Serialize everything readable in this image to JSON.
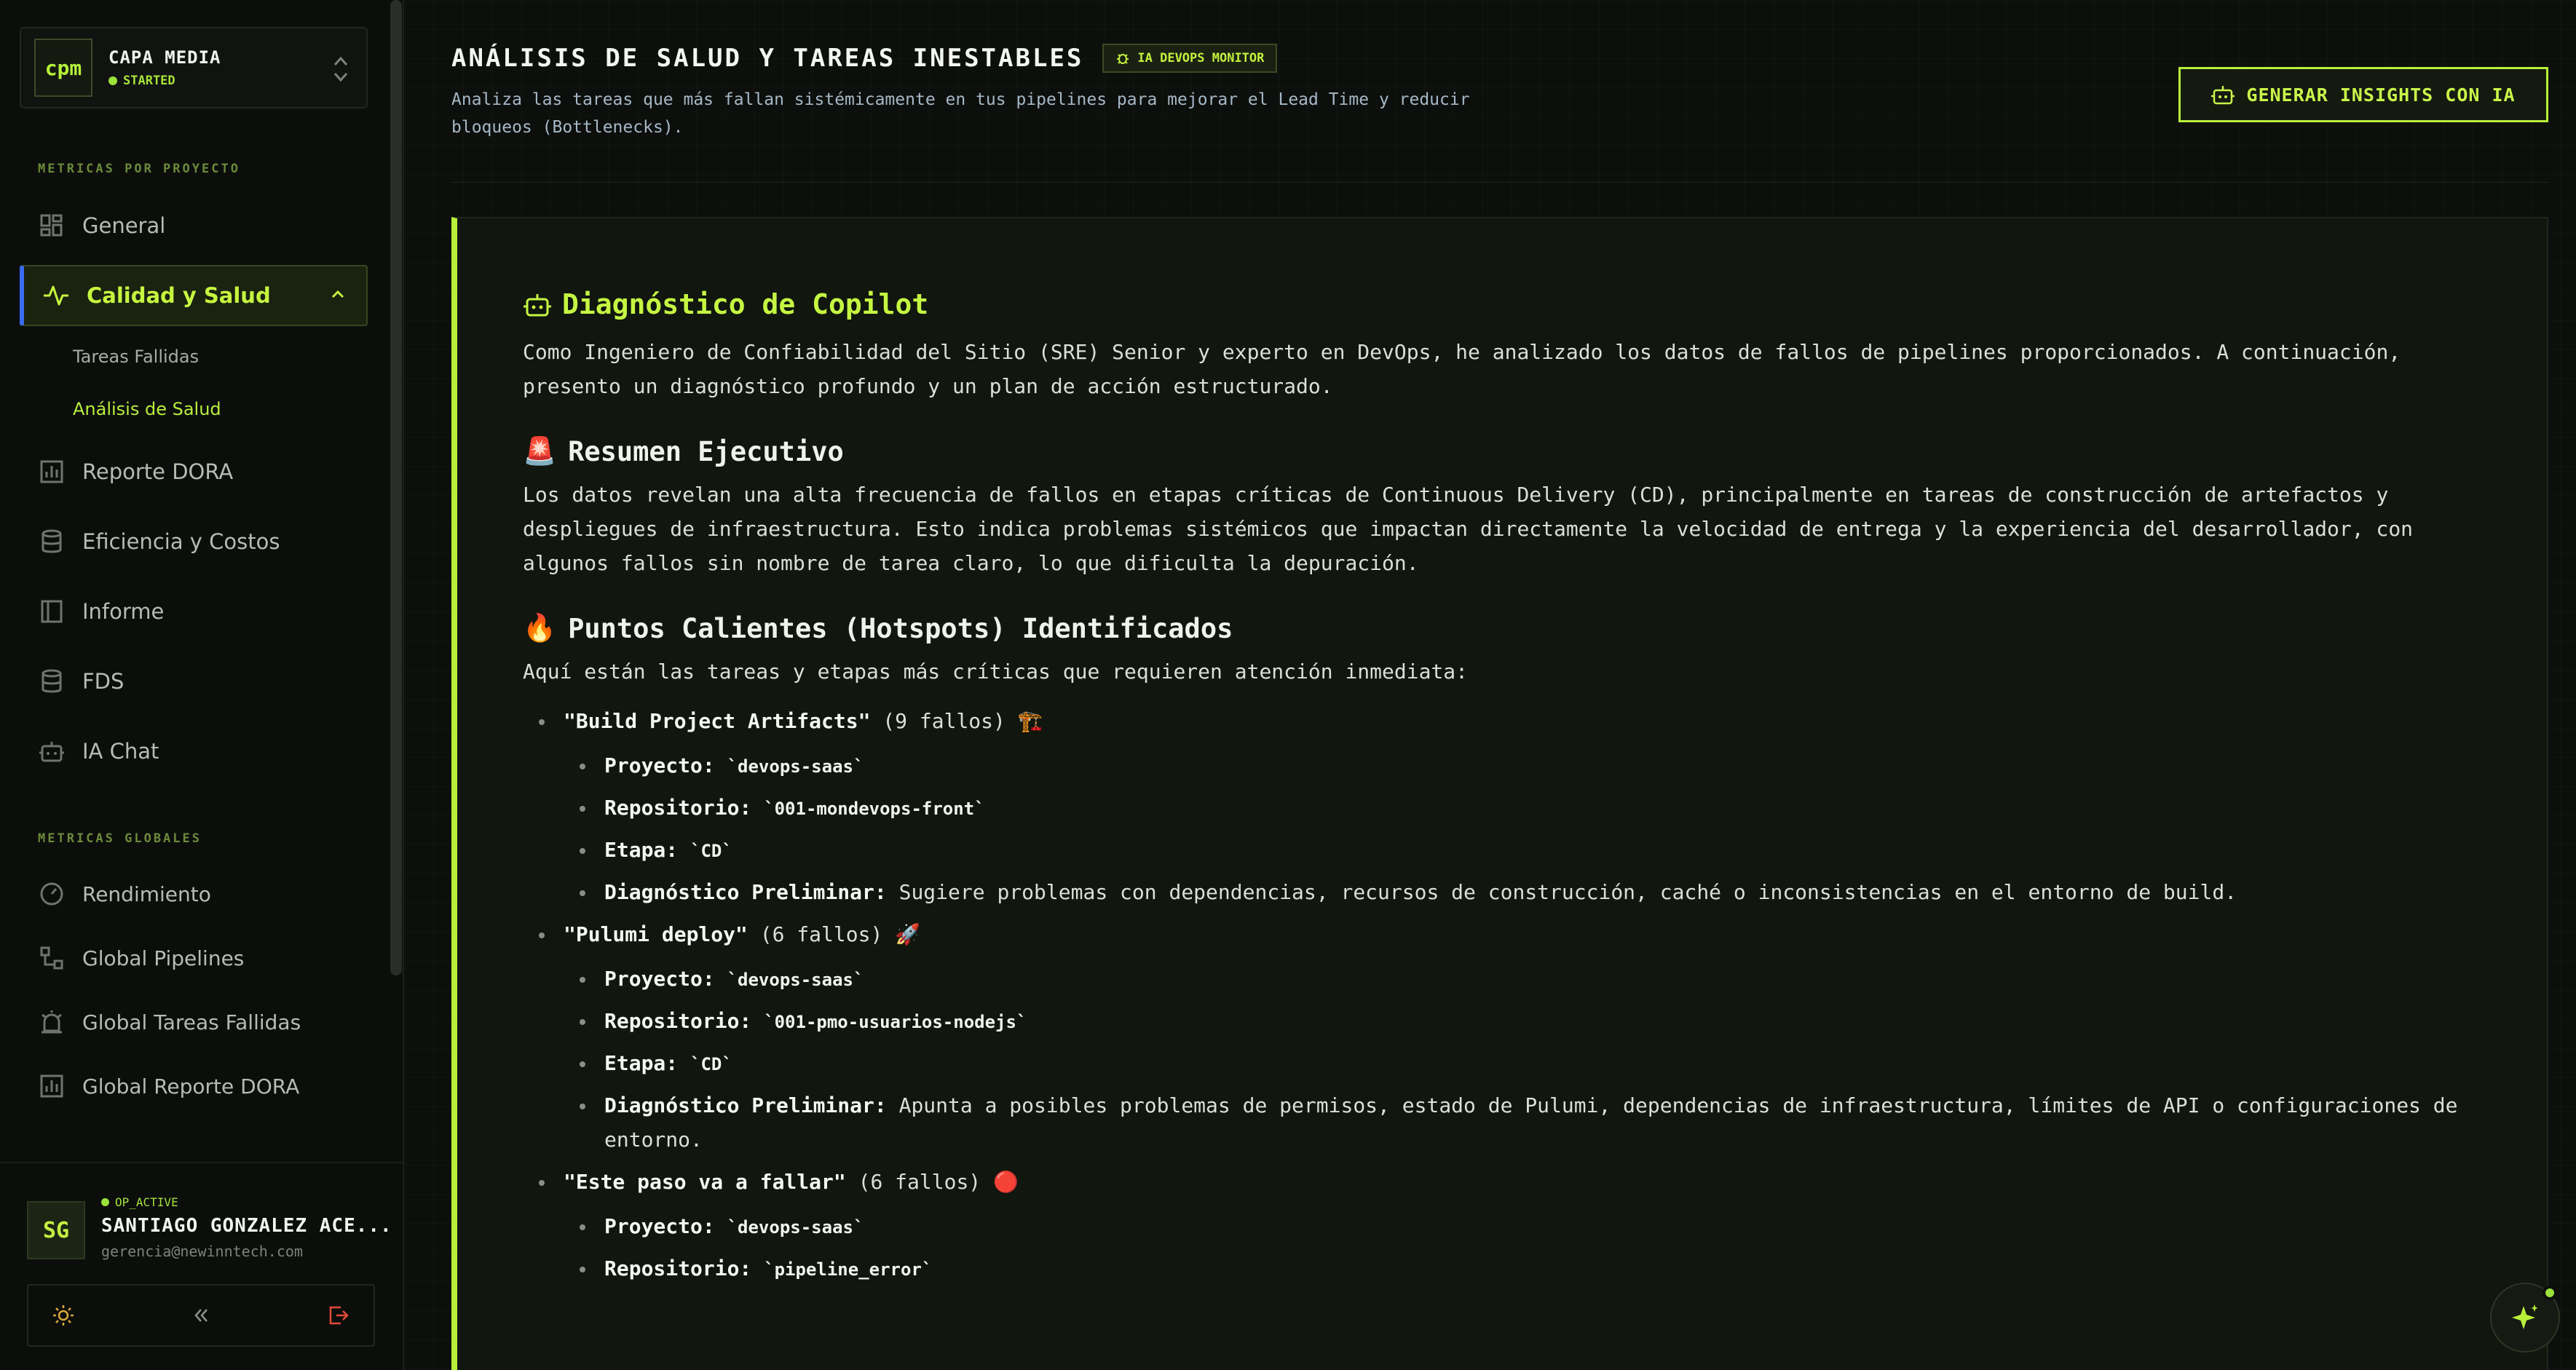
{
  "project": {
    "logo": "cpm",
    "name": "CAPA MEDIA",
    "status": "STARTED"
  },
  "sidebar": {
    "section_project": "METRICAS POR PROYECTO",
    "items_project": [
      {
        "label": "General",
        "icon": "dashboard-icon"
      },
      {
        "label": "Calidad y Salud",
        "icon": "activity-icon",
        "active": true
      },
      {
        "label": "Reporte DORA",
        "icon": "bar-chart-icon"
      },
      {
        "label": "Eficiencia y Costos",
        "icon": "database-icon"
      },
      {
        "label": "Informe",
        "icon": "panel-icon"
      },
      {
        "label": "FDS",
        "icon": "database-icon"
      },
      {
        "label": "IA Chat",
        "icon": "bot-icon"
      }
    ],
    "sub_items": [
      "Tareas Fallidas",
      "Análisis de Salud"
    ],
    "section_global": "METRICAS GLOBALES",
    "items_global": [
      {
        "label": "Rendimiento",
        "icon": "gauge-icon"
      },
      {
        "label": "Global Pipelines",
        "icon": "workflow-icon"
      },
      {
        "label": "Global Tareas Fallidas",
        "icon": "alarm-icon"
      },
      {
        "label": "Global Reporte DORA",
        "icon": "bar-chart-icon"
      }
    ]
  },
  "user": {
    "initials": "SG",
    "status": "OP_ACTIVE",
    "name": "SANTIAGO GONZALEZ ACE...",
    "email": "gerencia@newinntech.com"
  },
  "header": {
    "title": "ANÁLISIS DE SALUD Y TAREAS INESTABLES",
    "badge": "IA DEVOPS MONITOR",
    "subtitle": "Analiza las tareas que más fallan sistémicamente en tus pipelines para mejorar el Lead Time y reducir bloqueos (Bottlenecks).",
    "generate_button": "GENERAR INSIGHTS CON IA"
  },
  "report": {
    "title": "Diagnóstico de Copilot",
    "intro": "Como Ingeniero de Confiabilidad del Sitio (SRE) Senior y experto en DevOps, he analizado los datos de fallos de pipelines proporcionados. A continuación, presento un diagnóstico profundo y un plan de acción estructurado.",
    "summary_title": "Resumen Ejecutivo",
    "summary_emoji": "🚨",
    "summary": "Los datos revelan una alta frecuencia de fallos en etapas críticas de Continuous Delivery (CD), principalmente en tareas de construcción de artefactos y despliegues de infraestructura. Esto indica problemas sistémicos que impactan directamente la velocidad de entrega y la experiencia del desarrollador, con algunos fallos sin nombre de tarea claro, lo que dificulta la depuración.",
    "hotspots_title": "Puntos Calientes (Hotspots) Identificados",
    "hotspots_emoji": "🔥",
    "hotspots_intro": "Aquí están las tareas y etapas más críticas que requieren atención inmediata:",
    "labels": {
      "project": "Proyecto:",
      "repo": "Repositorio:",
      "stage": "Etapa:",
      "diag": "Diagnóstico Preliminar:"
    },
    "hotspots": [
      {
        "name": "\"Build Project Artifacts\"",
        "count": "(9 fallos)",
        "emoji": "🏗️",
        "project": "`devops-saas`",
        "repo": "`001-mondevops-front`",
        "stage": "`CD`",
        "diag": "Sugiere problemas con dependencias, recursos de construcción, caché o inconsistencias en el entorno de build."
      },
      {
        "name": "\"Pulumi deploy\"",
        "count": "(6 fallos)",
        "emoji": "🚀",
        "project": "`devops-saas`",
        "repo": "`001-pmo-usuarios-nodejs`",
        "stage": "`CD`",
        "diag": "Apunta a posibles problemas de permisos, estado de Pulumi, dependencias de infraestructura, límites de API o configuraciones de entorno."
      },
      {
        "name": "\"Este paso va a fallar\"",
        "count": "(6 fallos)",
        "emoji": "🔴",
        "project": "`devops-saas`",
        "repo": "`pipeline_error`"
      }
    ]
  },
  "colors": {
    "accent": "#b7f03a",
    "active_border": "#3b6cf0",
    "bg": "#0b0d0b"
  }
}
